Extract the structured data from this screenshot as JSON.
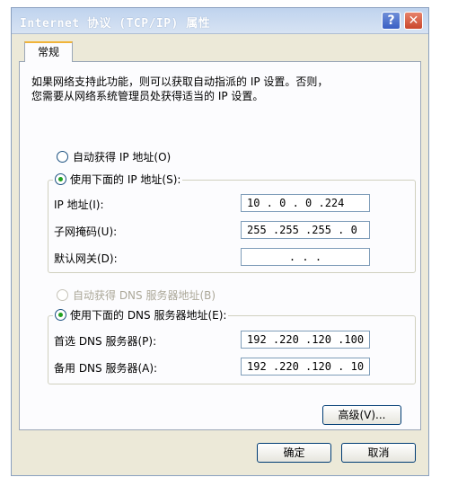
{
  "window": {
    "title": "Internet 协议 (TCP/IP) 属性",
    "help_glyph": "?",
    "close_glyph": "✕"
  },
  "tab": {
    "label": "常规"
  },
  "description": "如果网络支持此功能，则可以获取自动指派的 IP 设置。否则，\n您需要从网络系统管理员处获得适当的 IP 设置。",
  "ip": {
    "auto_label": "自动获得 IP 地址(O)",
    "manual_label": "使用下面的 IP 地址(S):",
    "mode": "manual",
    "fields": [
      {
        "label": "IP 地址(I):",
        "value": "10 . 0 . 0 .224"
      },
      {
        "label": "子网掩码(U):",
        "value": "255 .255 .255 . 0"
      },
      {
        "label": "默认网关(D):",
        "value": " . . . "
      }
    ]
  },
  "dns": {
    "auto_label": "自动获得 DNS 服务器地址(B)",
    "manual_label": "使用下面的 DNS 服务器地址(E):",
    "mode": "manual",
    "fields": [
      {
        "label": "首选 DNS 服务器(P):",
        "value": "192 .220 .120 .100"
      },
      {
        "label": "备用 DNS 服务器(A):",
        "value": "192 .220 .120 . 10"
      }
    ]
  },
  "buttons": {
    "advanced": "高级(V)...",
    "ok": "确定",
    "cancel": "取消"
  },
  "colors": {
    "titlebar": "#bfd3ee",
    "dialog_bg": "#ece9d8",
    "radio_dot": "#21a121",
    "tab_highlight": "#f0b43a"
  }
}
